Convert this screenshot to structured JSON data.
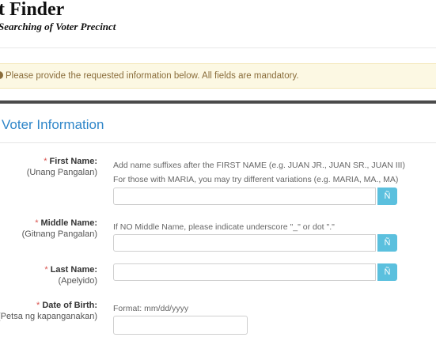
{
  "header": {
    "title": "t Finder",
    "subtitle": "Searching of Voter Precinct"
  },
  "alert": {
    "icon": "info-icon",
    "text": "Please provide the requested information below. All fields are mandatory."
  },
  "section": {
    "title": "Voter Information"
  },
  "required_mark": "*",
  "fields": {
    "first_name": {
      "label": "First Name:",
      "sublabel": "(Unang Pangalan)",
      "help1": "Add name suffixes after the FIRST NAME (e.g. JUAN JR., JUAN SR., JUAN III)",
      "help2": "For those with MARIA, you may try different variations (e.g. MARIA, MA., MA)",
      "value": "",
      "char_button": "Ñ"
    },
    "middle_name": {
      "label": "Middle Name:",
      "sublabel": "(Gitnang Pangalan)",
      "help1": "If NO Middle Name, please indicate underscore \"_\" or dot \".\"",
      "value": "",
      "char_button": "Ñ"
    },
    "last_name": {
      "label": "Last Name:",
      "sublabel": "(Apelyido)",
      "value": "",
      "char_button": "Ñ"
    },
    "dob": {
      "label": "Date of Birth:",
      "sublabel": "(Petsa ng kapanganakan)",
      "help1": "Format: mm/dd/yyyy",
      "value": ""
    }
  },
  "colors": {
    "accent": "#2f86c9",
    "alert_bg": "#fcf8e3",
    "alert_text": "#8a6d3b",
    "required": "#d9534f",
    "char_button": "#5bc0de"
  }
}
